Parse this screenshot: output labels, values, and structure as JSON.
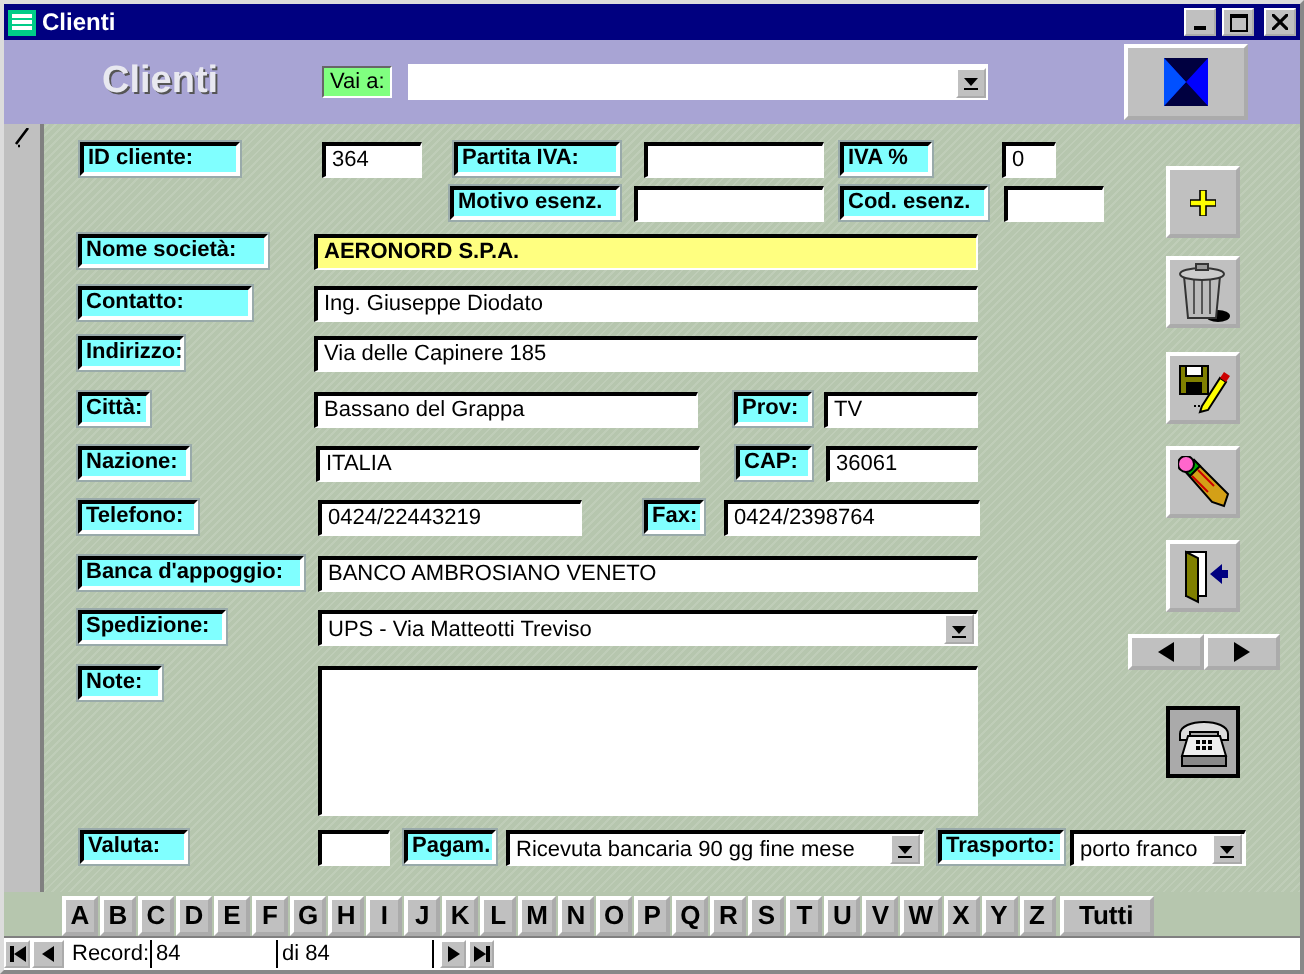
{
  "window": {
    "title": "Clienti"
  },
  "header": {
    "title": "Clienti",
    "goto_label": "Vai a:"
  },
  "fields": [
    {
      "label": "ID cliente:",
      "value": "364",
      "kind": "text",
      "focused": false
    },
    {
      "label": "Partita IVA:",
      "kind": "text",
      "focused": false
    },
    {
      "label": "IVA %",
      "value": "0",
      "kind": "text",
      "focused": false
    },
    {
      "label": "Motivo esenz.",
      "kind": "text",
      "focused": false
    },
    {
      "label": "Cod. esenz.",
      "kind": "text",
      "focused": false
    },
    {
      "label": "Nome società:",
      "value": "AERONORD S.P.A.",
      "kind": "text",
      "focused": true
    },
    {
      "label": "Contatto:",
      "value": "Ing. Giuseppe Diodato",
      "kind": "text",
      "focused": false
    },
    {
      "label": "Indirizzo:",
      "value": "Via delle Capinere 185",
      "kind": "text",
      "focused": false
    },
    {
      "label": "Città:",
      "value": "Bassano del Grappa",
      "kind": "text",
      "focused": false
    },
    {
      "label": "Prov:",
      "value": "TV",
      "kind": "text",
      "focused": false
    },
    {
      "label": "Nazione:",
      "value": "ITALIA",
      "kind": "text",
      "focused": false
    },
    {
      "label": "CAP:",
      "value": "36061",
      "kind": "text",
      "focused": false
    },
    {
      "label": "Telefono:",
      "value": "0424/22443219",
      "kind": "text",
      "focused": false
    },
    {
      "label": "Fax:",
      "value": "0424/2398764",
      "kind": "text",
      "focused": false
    },
    {
      "label": "Banca d'appoggio:",
      "value": "BANCO AMBROSIANO VENETO",
      "kind": "text",
      "focused": false
    },
    {
      "label": "Spedizione:",
      "value": "UPS  - Via Matteotti  Treviso",
      "kind": "combo",
      "focused": false
    },
    {
      "label": "Note:",
      "kind": "memo",
      "focused": false
    },
    {
      "label": "Valuta:",
      "kind": "text",
      "focused": false
    },
    {
      "label": "Pagam.",
      "value": "Ricevuta bancaria 90 gg fine mese",
      "kind": "combo",
      "focused": false
    },
    {
      "label": "Trasporto:",
      "value": "porto franco",
      "kind": "combo",
      "focused": false
    }
  ],
  "alphabet_tabs": [
    "A",
    "B",
    "C",
    "D",
    "E",
    "F",
    "G",
    "H",
    "I",
    "J",
    "K",
    "L",
    "M",
    "N",
    "O",
    "P",
    "Q",
    "R",
    "S",
    "T",
    "U",
    "V",
    "W",
    "X",
    "Y",
    "Z",
    "Tutti"
  ],
  "navigation": {
    "label": "Record:",
    "current": "84",
    "total": "di 84"
  }
}
